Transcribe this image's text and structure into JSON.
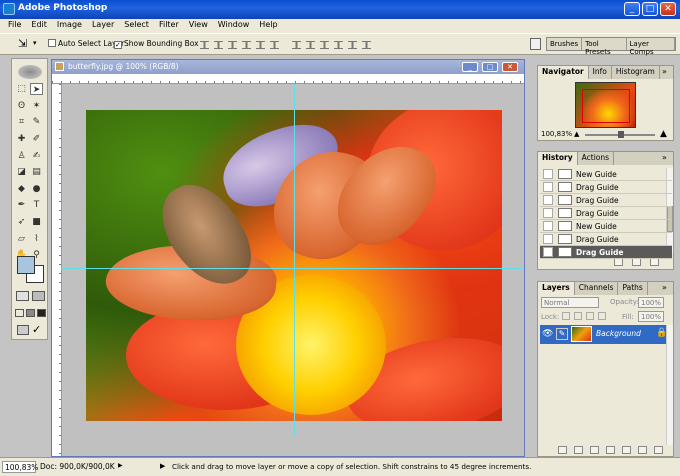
{
  "app": {
    "title": "Adobe Photoshop",
    "window_buttons": [
      "_",
      "□",
      "✕"
    ]
  },
  "menus": [
    "File",
    "Edit",
    "Image",
    "Layer",
    "Select",
    "Filter",
    "View",
    "Window",
    "Help"
  ],
  "options": {
    "auto_select_label": "Auto Select Layer",
    "auto_select_checked": false,
    "bounding_box_label": "Show Bounding Box",
    "bounding_box_checked": true,
    "tool_glyph": "⇲",
    "arrow": "▾"
  },
  "palette_well": {
    "tabs": [
      "Brushes",
      "Tool Presets",
      "Layer Comps"
    ]
  },
  "document": {
    "title": "butterfly.jpg @ 100% (RGB/8)",
    "zoom": "100,83%",
    "doc_size": "Doc: 900,0K/900,0K",
    "status_hint": "Click and drag to move layer or move a copy of selection. Shift constrains to 45 degree increments."
  },
  "navigator": {
    "tabs": [
      "Navigator",
      "Info",
      "Histogram"
    ],
    "zoom": "100,83%"
  },
  "history": {
    "tabs": [
      "History",
      "Actions"
    ],
    "items": [
      "New Guide",
      "Drag Guide",
      "Drag Guide",
      "Drag Guide",
      "New Guide",
      "Drag Guide",
      "Drag Guide"
    ],
    "selected_index": 6
  },
  "layers": {
    "tabs": [
      "Layers",
      "Channels",
      "Paths"
    ],
    "blend_mode": "Normal",
    "opacity_label": "Opacity:",
    "opacity": "100%",
    "lock_label": "Lock:",
    "fill_label": "Fill:",
    "fill": "100%",
    "items": [
      {
        "name": "Background",
        "visible": true,
        "locked": true
      }
    ]
  },
  "colors": {
    "fg": "#a9c4dd",
    "bg": "#ffffff",
    "accent": "#316ac5"
  }
}
